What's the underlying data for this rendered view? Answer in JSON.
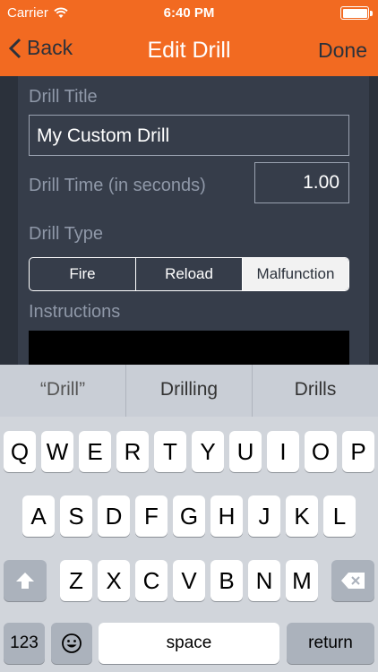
{
  "status": {
    "carrier": "Carrier",
    "time": "6:40 PM"
  },
  "nav": {
    "back": "Back",
    "title": "Edit Drill",
    "done": "Done"
  },
  "form": {
    "title_label": "Drill Title",
    "title_value": "My Custom Drill",
    "time_label": "Drill Time (in seconds)",
    "time_value": "1.00",
    "type_label": "Drill Type",
    "types": [
      "Fire",
      "Reload",
      "Malfunction"
    ],
    "selected_type": "Malfunction",
    "instructions_label": "Instructions"
  },
  "keyboard": {
    "suggestions": [
      "“Drill”",
      "Drilling",
      "Drills"
    ],
    "row1": [
      "Q",
      "W",
      "E",
      "R",
      "T",
      "Y",
      "U",
      "I",
      "O",
      "P"
    ],
    "row2": [
      "A",
      "S",
      "D",
      "F",
      "G",
      "H",
      "J",
      "K",
      "L"
    ],
    "row3": [
      "Z",
      "X",
      "C",
      "V",
      "B",
      "N",
      "M"
    ],
    "numbers": "123",
    "space": "space",
    "return": "return"
  }
}
